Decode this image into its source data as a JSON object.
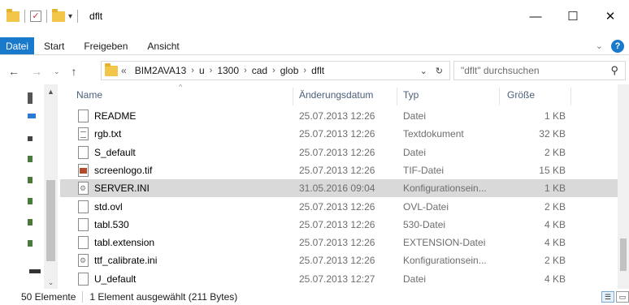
{
  "window": {
    "title": "dflt",
    "controls": [
      "—",
      "☐",
      "✕"
    ]
  },
  "ribbon": {
    "tabs": [
      "Datei",
      "Start",
      "Freigeben",
      "Ansicht"
    ],
    "collapse_icon": "chevron-down-icon",
    "help": "?"
  },
  "address": {
    "prefix": "«",
    "crumbs": [
      "BIM2AVA13",
      "u",
      "1300",
      "cad",
      "glob",
      "dflt"
    ],
    "dropdown": "⌄",
    "refresh": "↻"
  },
  "search": {
    "placeholder": "\"dflt\" durchsuchen"
  },
  "columns": {
    "name": "Name",
    "date": "Änderungsdatum",
    "type": "Typ",
    "size": "Größe"
  },
  "files": [
    {
      "name": "README",
      "date": "25.07.2013 12:26",
      "type": "Datei",
      "size": "1 KB",
      "icon": "file"
    },
    {
      "name": "rgb.txt",
      "date": "25.07.2013 12:26",
      "type": "Textdokument",
      "size": "32 KB",
      "icon": "txt"
    },
    {
      "name": "S_default",
      "date": "25.07.2013 12:26",
      "type": "Datei",
      "size": "2 KB",
      "icon": "file"
    },
    {
      "name": "screenlogo.tif",
      "date": "25.07.2013 12:26",
      "type": "TIF-Datei",
      "size": "15 KB",
      "icon": "img"
    },
    {
      "name": "SERVER.INI",
      "date": "31.05.2016 09:04",
      "type": "Konfigurationsein...",
      "size": "1 KB",
      "icon": "ini"
    },
    {
      "name": "std.ovl",
      "date": "25.07.2013 12:26",
      "type": "OVL-Datei",
      "size": "2 KB",
      "icon": "file"
    },
    {
      "name": "tabl.530",
      "date": "25.07.2013 12:26",
      "type": "530-Datei",
      "size": "4 KB",
      "icon": "file"
    },
    {
      "name": "tabl.extension",
      "date": "25.07.2013 12:26",
      "type": "EXTENSION-Datei",
      "size": "4 KB",
      "icon": "file"
    },
    {
      "name": "ttf_calibrate.ini",
      "date": "25.07.2013 12:26",
      "type": "Konfigurationsein...",
      "size": "2 KB",
      "icon": "ini"
    },
    {
      "name": "U_default",
      "date": "25.07.2013 12:27",
      "type": "Datei",
      "size": "4 KB",
      "icon": "file"
    }
  ],
  "selected_index": 4,
  "status": {
    "count": "50 Elemente",
    "selection": "1 Element ausgewählt (211 Bytes)"
  }
}
